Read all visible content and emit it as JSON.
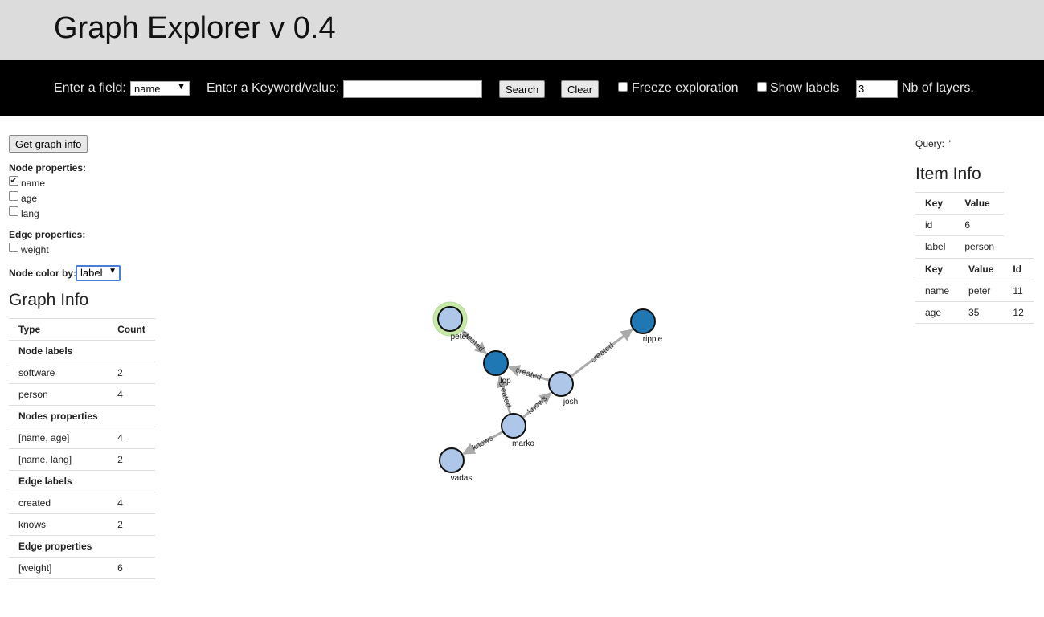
{
  "header": {
    "title": "Graph Explorer v 0.4"
  },
  "toolbar": {
    "field_label": "Enter a field:",
    "field_value": "name",
    "keyword_label": "Enter a Keyword/value:",
    "keyword_value": "",
    "search_label": "Search",
    "clear_label": "Clear",
    "freeze_label": "Freeze exploration",
    "freeze_checked": false,
    "labels_label": "Show labels",
    "labels_checked": false,
    "layers_value": "3",
    "layers_label": "Nb of layers."
  },
  "sidebar": {
    "get_info_label": "Get graph info",
    "node_props_title": "Node properties:",
    "node_props": [
      {
        "label": "name",
        "checked": true
      },
      {
        "label": "age",
        "checked": false
      },
      {
        "label": "lang",
        "checked": false
      }
    ],
    "edge_props_title": "Edge properties:",
    "edge_props": [
      {
        "label": "weight",
        "checked": false
      }
    ],
    "color_by_label": "Node color by:",
    "color_by_value": "label",
    "graph_info_title": "Graph Info",
    "graph_info": {
      "headers": [
        "Type",
        "Count"
      ],
      "rows": [
        {
          "type": "Node labels",
          "count": "",
          "section": true
        },
        {
          "type": "software",
          "count": "2"
        },
        {
          "type": "person",
          "count": "4"
        },
        {
          "type": "Nodes properties",
          "count": "",
          "section": true
        },
        {
          "type": "[name, age]",
          "count": "4"
        },
        {
          "type": "[name, lang]",
          "count": "2"
        },
        {
          "type": "Edge labels",
          "count": "",
          "section": true
        },
        {
          "type": "created",
          "count": "4"
        },
        {
          "type": "knows",
          "count": "2"
        },
        {
          "type": "Edge properties",
          "count": "",
          "section": true
        },
        {
          "type": "[weight]",
          "count": "6"
        }
      ]
    }
  },
  "item_panel": {
    "query_text": "Query: ''",
    "title": "Item Info",
    "table1": {
      "headers": [
        "Key",
        "Value"
      ],
      "rows": [
        [
          "id",
          "6"
        ],
        [
          "label",
          "person"
        ]
      ]
    },
    "table2": {
      "headers": [
        "Key",
        "Value",
        "Id"
      ],
      "rows": [
        [
          "name",
          "peter",
          "11"
        ],
        [
          "age",
          "35",
          "12"
        ]
      ]
    }
  },
  "graph": {
    "colors": {
      "person": "#aec7e8",
      "software": "#1f77b4",
      "selected_halo": "#c7e9a8",
      "edge": "#aaaaaa"
    },
    "selected_node": "peter",
    "nodes": [
      {
        "id": "peter",
        "label": "peter",
        "type": "person"
      },
      {
        "id": "lop",
        "label": "lop",
        "type": "software"
      },
      {
        "id": "ripple",
        "label": "ripple",
        "type": "software"
      },
      {
        "id": "josh",
        "label": "josh",
        "type": "person"
      },
      {
        "id": "marko",
        "label": "marko",
        "type": "person"
      },
      {
        "id": "vadas",
        "label": "vadas",
        "type": "person"
      }
    ],
    "edges": [
      {
        "source": "peter",
        "target": "lop",
        "label": "created"
      },
      {
        "source": "josh",
        "target": "lop",
        "label": "created"
      },
      {
        "source": "josh",
        "target": "ripple",
        "label": "created"
      },
      {
        "source": "marko",
        "target": "lop",
        "label": "created"
      },
      {
        "source": "marko",
        "target": "josh",
        "label": "knows"
      },
      {
        "source": "marko",
        "target": "vadas",
        "label": "knows"
      }
    ]
  }
}
